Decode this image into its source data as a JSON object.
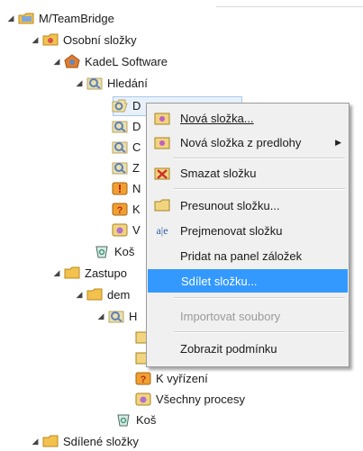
{
  "tree": {
    "rows": [
      {
        "label": "M/TeamBridge",
        "icon": "database-icon"
      },
      {
        "label": "Osobní složky",
        "icon": "personal-folders-icon"
      },
      {
        "label": "KadeL Software",
        "icon": "company-icon"
      },
      {
        "label": "Hledání",
        "icon": "search-folder-icon"
      },
      {
        "label": "D",
        "icon": "search-folder-icon"
      },
      {
        "label": "D",
        "icon": "search-folder-icon"
      },
      {
        "label": "C",
        "icon": "search-folder-icon"
      },
      {
        "label": "Z",
        "icon": "search-folder-icon"
      },
      {
        "label": "N",
        "icon": "exclamation-icon"
      },
      {
        "label": "K",
        "icon": "question-icon"
      },
      {
        "label": "V",
        "icon": "process-icon"
      },
      {
        "label": "Koš",
        "icon": "trash-icon"
      },
      {
        "label": "Zastupo",
        "icon": "folder-icon"
      },
      {
        "label": "dem",
        "icon": "folder-icon"
      },
      {
        "label": "H",
        "icon": "search-folder-icon"
      },
      {
        "label": "K vyřízení",
        "icon": "question-icon"
      },
      {
        "label": "Všechny procesy",
        "icon": "process-icon"
      },
      {
        "label": "Koš",
        "icon": "trash-icon"
      },
      {
        "label": "Sdílené složky",
        "icon": "folder-icon"
      }
    ]
  },
  "menu": {
    "items": [
      {
        "label": "Nová složka...",
        "icon": "new-folder-icon"
      },
      {
        "label": "Nová složka z predlohy",
        "icon": "template-folder-icon",
        "submenu": "▶"
      },
      {
        "label": "Smazat složku",
        "icon": "delete-folder-icon"
      },
      {
        "label": "Presunout složku...",
        "icon": "move-folder-icon"
      },
      {
        "label": "Prejmenovat složku",
        "icon": "rename-icon"
      },
      {
        "label": "Pridat na panel záložek",
        "icon": ""
      },
      {
        "label": "Sdílet složku...",
        "icon": ""
      },
      {
        "label": "Importovat soubory",
        "icon": ""
      },
      {
        "label": "Zobrazit podmínku",
        "icon": ""
      }
    ]
  },
  "colors": {
    "highlight": "#3399ff",
    "folder": "#f2c14e",
    "search": "#6a8fc6"
  }
}
